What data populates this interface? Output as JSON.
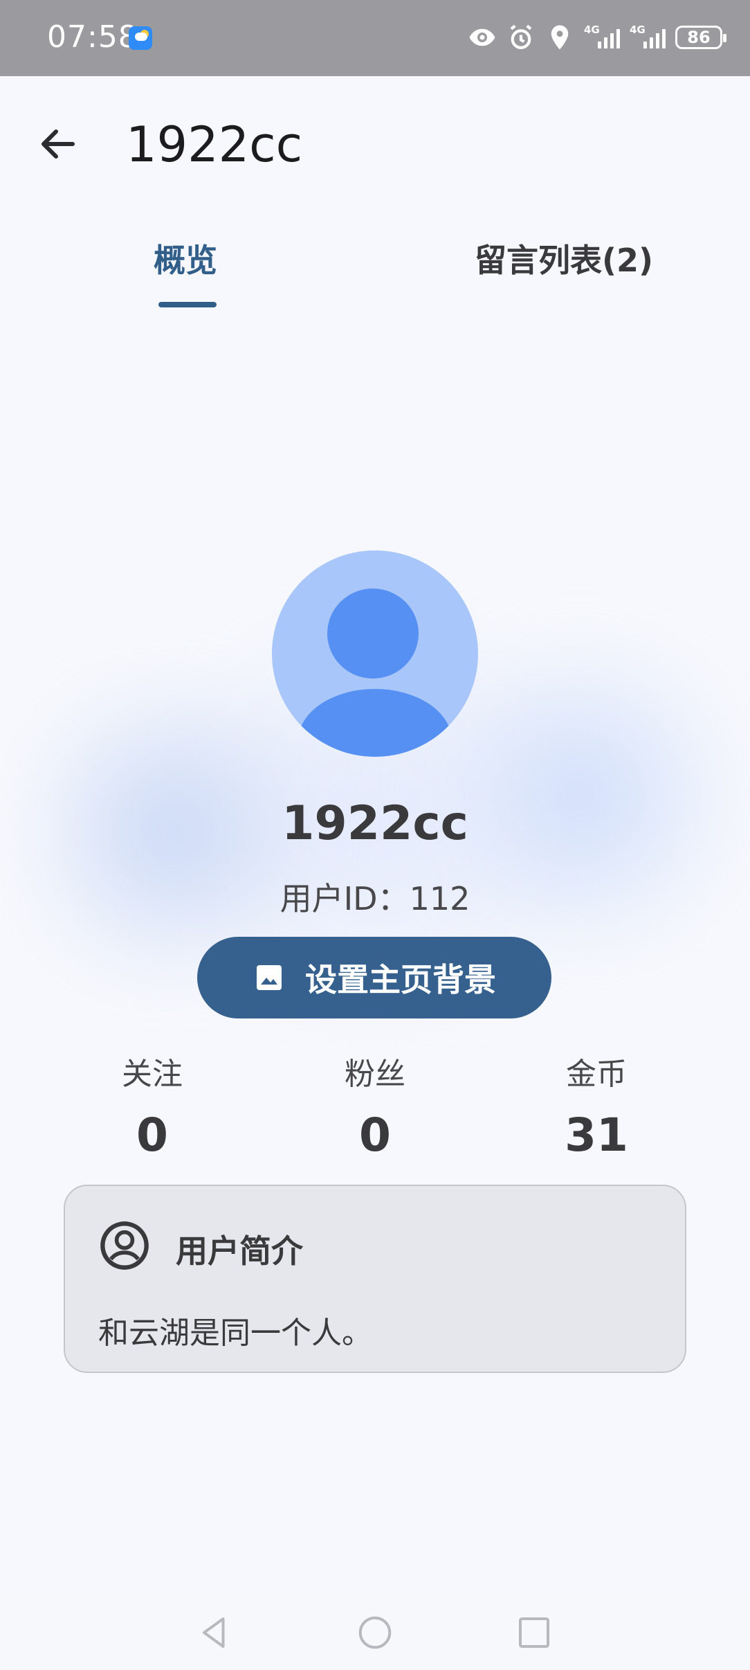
{
  "status_bar": {
    "time": "07:58",
    "network_1": "4G",
    "network_2": "4G",
    "battery": "86",
    "icons": [
      "weather-icon",
      "eye-icon",
      "alarm-icon",
      "location-icon",
      "signal-icon",
      "signal-icon",
      "battery-icon"
    ]
  },
  "header": {
    "title": "1922cc",
    "back_icon": "arrow-left-icon"
  },
  "tabs": [
    {
      "label": "概览",
      "selected": true
    },
    {
      "label": "留言列表(2)",
      "selected": false
    }
  ],
  "profile": {
    "avatar_icon": "default-avatar-icon",
    "username": "1922cc",
    "user_id": "用户ID：112",
    "set_background_button": "设置主页背景",
    "set_background_icon": "image-icon"
  },
  "stats": [
    {
      "label": "关注",
      "value": "0"
    },
    {
      "label": "粉丝",
      "value": "0"
    },
    {
      "label": "金币",
      "value": "31"
    }
  ],
  "bio": {
    "icon": "account-circle-icon",
    "title": "用户简介",
    "text": "和云湖是同一个人。"
  },
  "nav_bar": {
    "icons": [
      "nav-back-icon",
      "nav-home-icon",
      "nav-recent-icon"
    ]
  },
  "colors": {
    "accent": "#36618e",
    "avatar_bg": "#a8c6fa",
    "avatar_fg": "#5590f2",
    "page_bg": "#f6f8fd",
    "status_bar": "#9b9b9f"
  }
}
